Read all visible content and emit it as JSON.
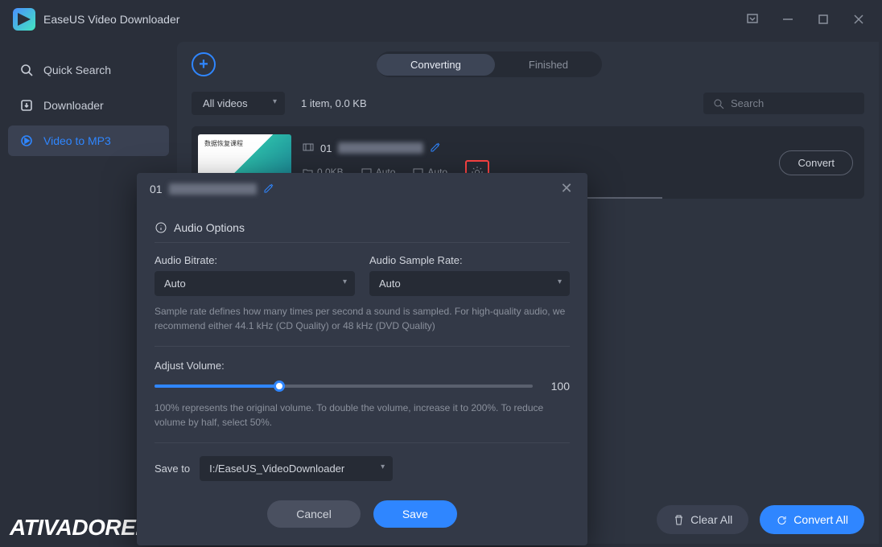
{
  "app": {
    "title": "EaseUS Video Downloader"
  },
  "sidebar": {
    "items": [
      {
        "label": "Quick Search"
      },
      {
        "label": "Downloader"
      },
      {
        "label": "Video to MP3"
      }
    ]
  },
  "tabs": {
    "converting": "Converting",
    "finished": "Finished"
  },
  "toolbar": {
    "filter": "All videos",
    "count_text": "1 item, 0.0 KB",
    "search_placeholder": "Search"
  },
  "row": {
    "title_prefix": "01",
    "size": "0.0KB",
    "meta1": "Auto",
    "meta2": "Auto",
    "convert_label": "Convert"
  },
  "modal": {
    "title_prefix": "01",
    "section": "Audio Options",
    "bitrate_label": "Audio Bitrate:",
    "bitrate_value": "Auto",
    "samplerate_label": "Audio Sample Rate:",
    "samplerate_value": "Auto",
    "samplerate_hint": "Sample rate defines how many times per second a sound is sampled. For high-quality audio, we recommend either 44.1 kHz (CD Quality) or 48 kHz (DVD Quality)",
    "volume_label": "Adjust Volume:",
    "volume_value": "100",
    "volume_hint": "100% represents the original volume. To double the volume, increase it to 200%. To reduce volume by half, select 50%.",
    "saveto_label": "Save to",
    "saveto_path": "I:/EaseUS_VideoDownloader",
    "cancel": "Cancel",
    "save": "Save"
  },
  "footer": {
    "clear": "Clear All",
    "convert_all": "Convert All"
  },
  "watermark": "ATIVADORE.ORG"
}
